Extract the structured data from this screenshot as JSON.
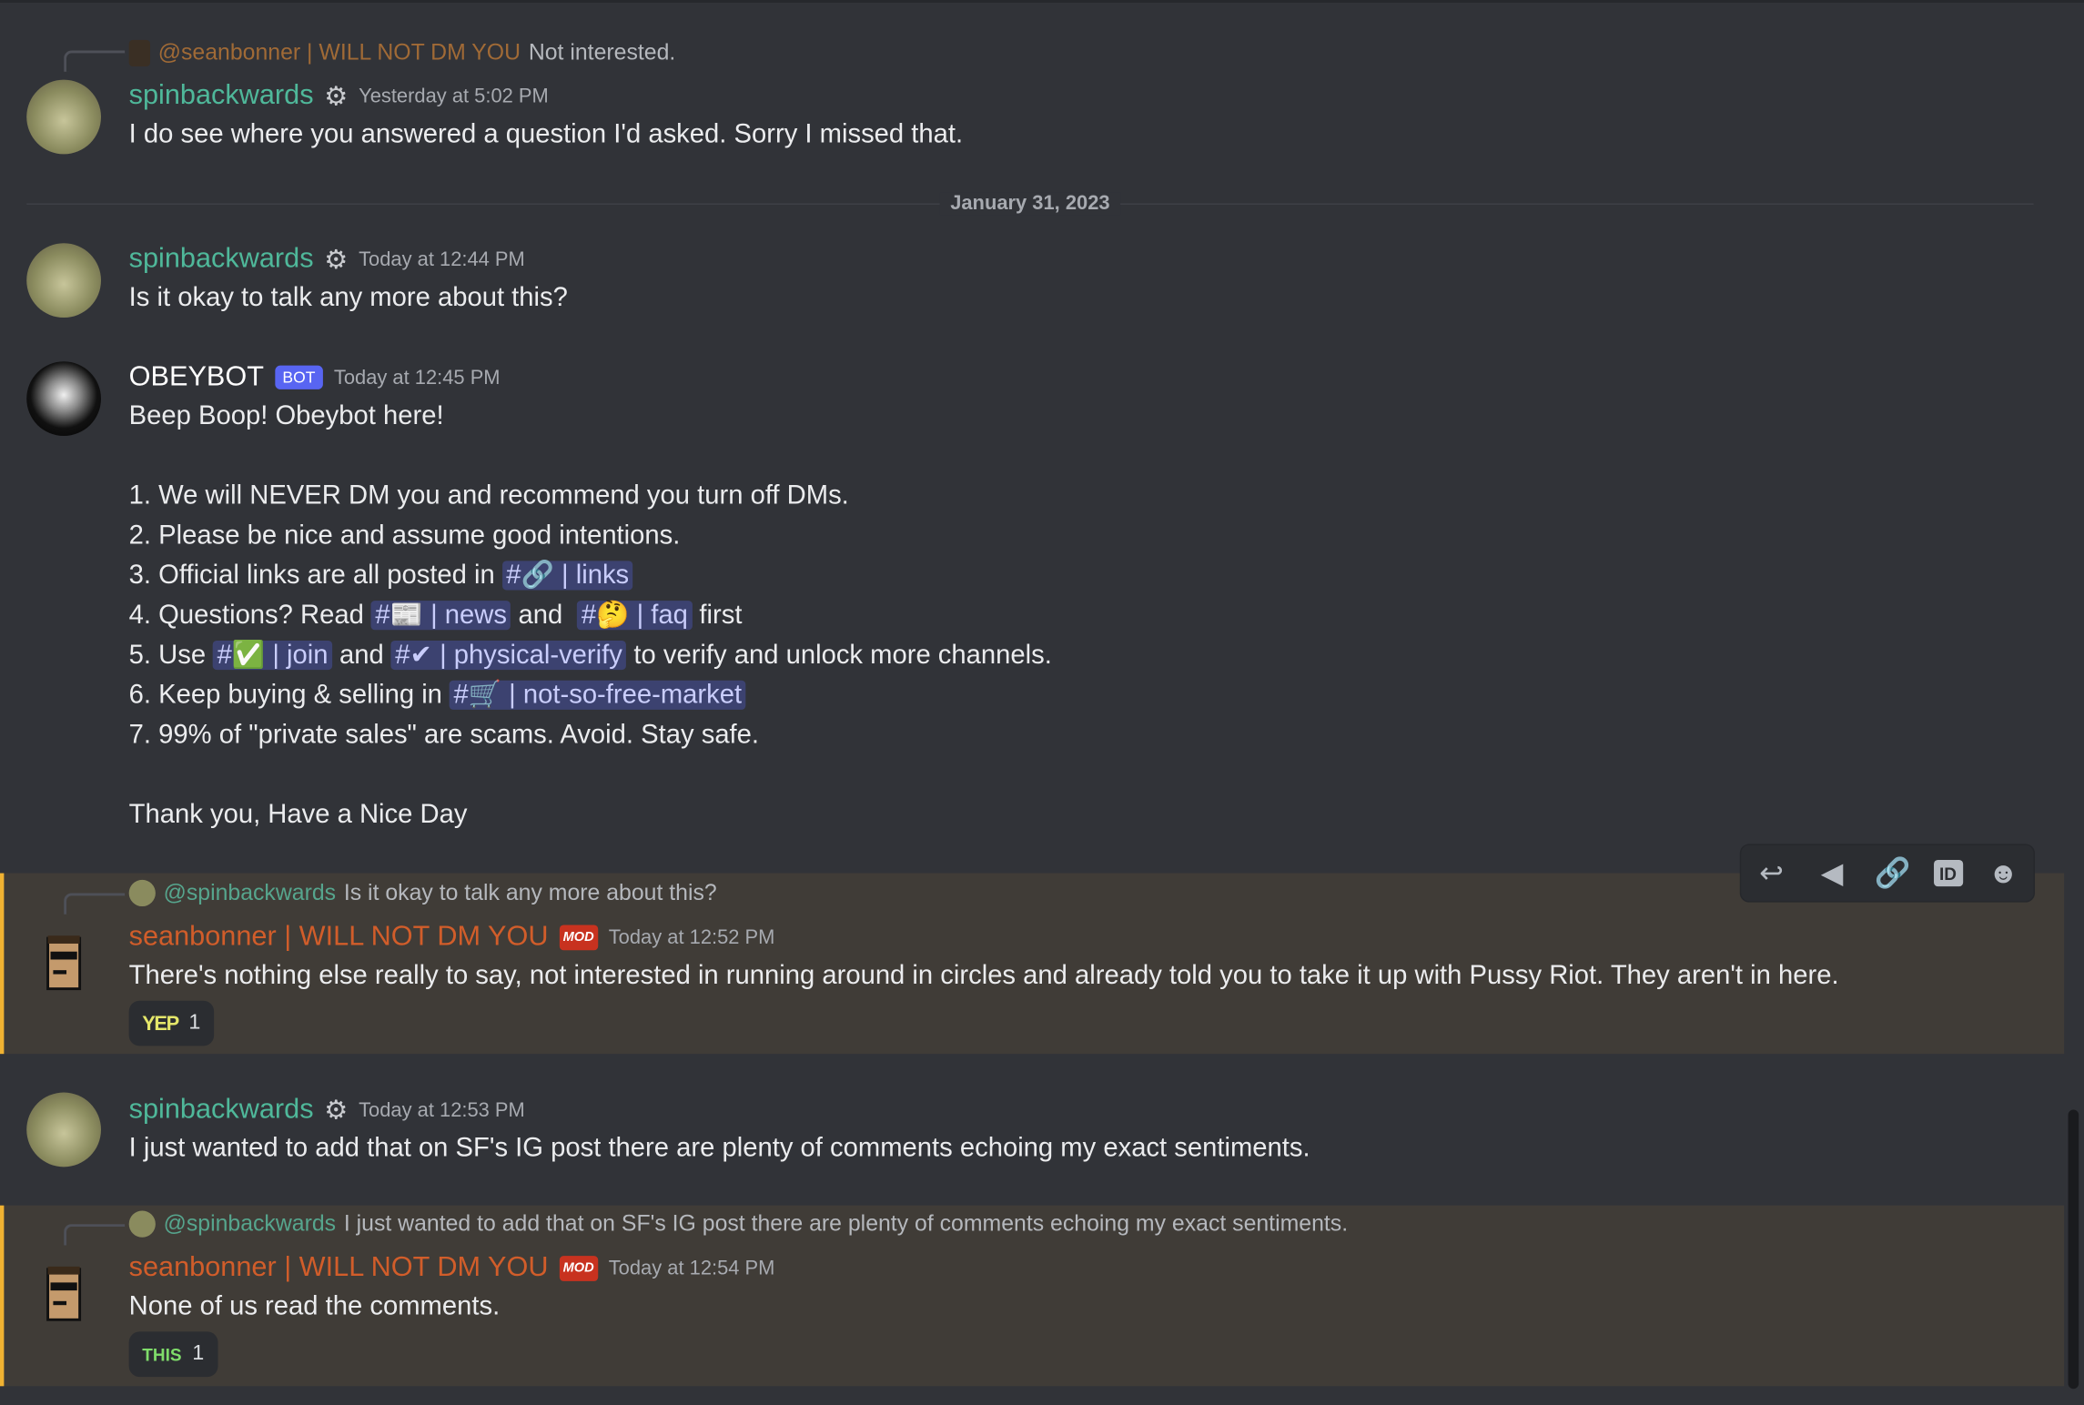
{
  "date_divider": "January 31, 2023",
  "messages": [
    {
      "reply": {
        "mention": "@seanbonner | WILL NOT DM YOU",
        "text": "Not interested."
      },
      "author": "spinbackwards",
      "timestamp": "Yesterday at 5:02 PM",
      "text": "I do see where you answered a question I'd asked. Sorry I missed that."
    },
    {
      "author": "spinbackwards",
      "timestamp": "Today at 12:44 PM",
      "text": "Is it okay to talk any more about this?"
    },
    {
      "author": "OBEYBOT",
      "badge": "BOT",
      "timestamp": "Today at 12:45 PM",
      "lines": {
        "greeting": "Beep Boop! Obeybot here!",
        "l1": "1. We will NEVER DM you and recommend you turn off DMs.",
        "l2": "2. Please be nice and assume good intentions.",
        "l3_pre": "3. Official links are all posted in",
        "l4_pre": "4. Questions? Read",
        "l4_mid": "and",
        "l4_post": "first",
        "l5_pre": "5. Use",
        "l5_mid": "and",
        "l5_post": "to verify and unlock more channels.",
        "l6_pre": "6. Keep buying & selling in",
        "l7": "7. 99% of \"private sales\" are scams. Avoid. Stay safe.",
        "closing": "Thank you, Have a Nice Day"
      },
      "channels": {
        "links": "#🔗 | links",
        "news": "#📰 | news",
        "faq": "#🤔 | faq",
        "join": "#✅ | join",
        "verify": "#✔ | physical-verify",
        "market": "#🛒 | not-so-free-market"
      }
    },
    {
      "reply": {
        "mention": "@spinbackwards",
        "text": "Is it okay to talk any more about this?"
      },
      "author": "seanbonner | WILL NOT DM YOU",
      "badge": "MOD",
      "timestamp": "Today at 12:52 PM",
      "text": "There's nothing else really to say, not interested in running around in circles and already told you to take it up with Pussy Riot. They aren't in here.",
      "reaction": {
        "emoji": "YEP",
        "count": "1"
      }
    },
    {
      "author": "spinbackwards",
      "timestamp": "Today at 12:53 PM",
      "text": "I just wanted to add that on SF's IG post there are plenty of comments echoing my exact sentiments."
    },
    {
      "reply": {
        "mention": "@spinbackwards",
        "text": "I just wanted to add that on SF's IG post there are plenty of comments echoing my exact sentiments."
      },
      "author": "seanbonner | WILL NOT DM YOU",
      "badge": "MOD",
      "timestamp": "Today at 12:54 PM",
      "text": "None of us read the comments.",
      "reaction": {
        "emoji": "THIS",
        "count": "1"
      }
    }
  ],
  "toolbar": [
    "reply-icon",
    "forward-icon",
    "link-icon",
    "id-icon",
    "emoji-icon"
  ],
  "colors": {
    "background": "#313338",
    "spin": "#4fb89a",
    "sean": "#d15d2a",
    "highlight": "#f0b232"
  }
}
